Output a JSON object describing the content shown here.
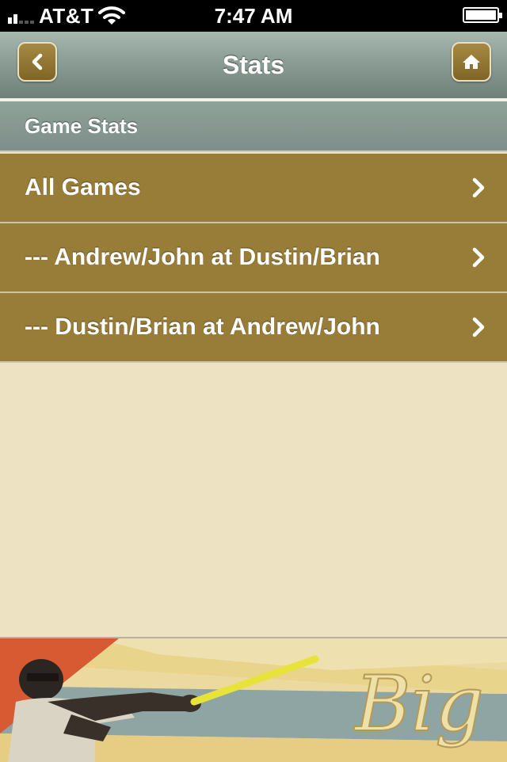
{
  "status_bar": {
    "carrier": "AT&T",
    "time": "7:47 AM"
  },
  "nav": {
    "title": "Stats",
    "back_icon": "chevron-left-icon",
    "home_icon": "home-icon"
  },
  "section": {
    "title": "Game Stats"
  },
  "list": {
    "items": [
      {
        "label": "All Games"
      },
      {
        "label": "--- Andrew/John at Dustin/Brian"
      },
      {
        "label": "--- Dustin/Brian at Andrew/John"
      }
    ]
  },
  "banner": {
    "logo_text": "Big"
  },
  "colors": {
    "nav_bar": "#8b9d95",
    "list_item": "#987d38",
    "background": "#ede3c3",
    "button_gold": "#a68944"
  }
}
